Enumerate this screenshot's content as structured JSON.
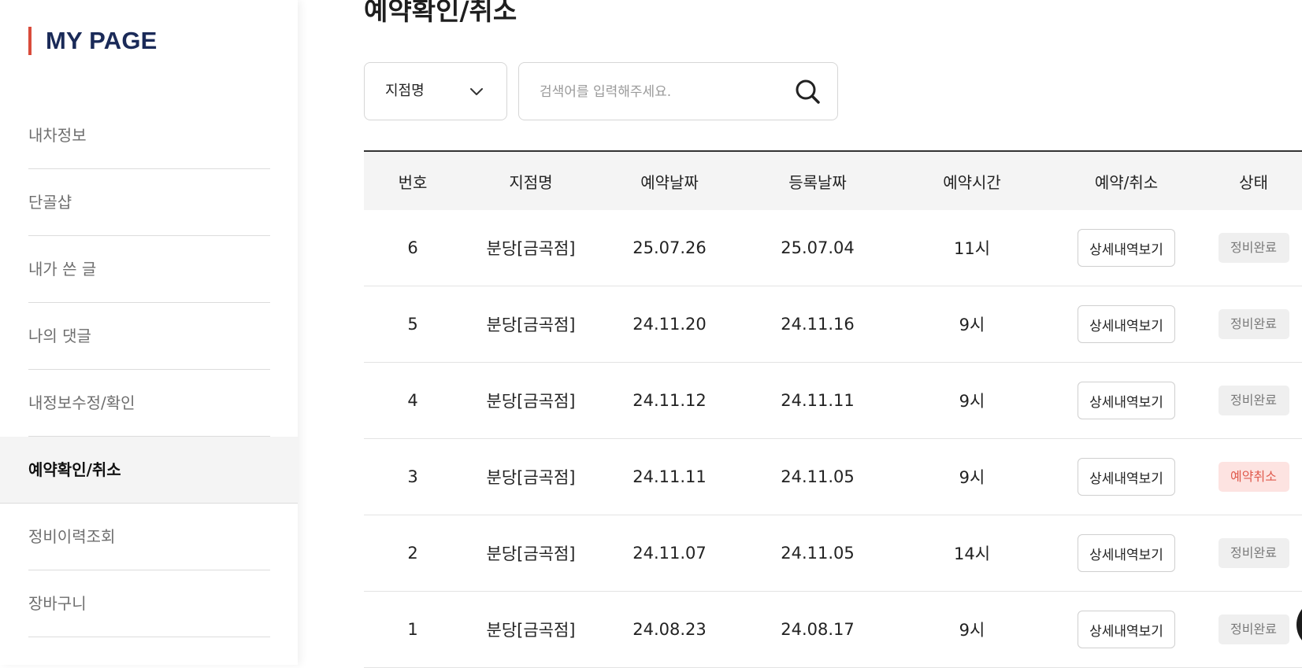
{
  "sidebar": {
    "title": "MY PAGE",
    "items": [
      {
        "label": "내차정보"
      },
      {
        "label": "단골샵"
      },
      {
        "label": "내가 쓴 글"
      },
      {
        "label": "나의 댓글"
      },
      {
        "label": "내정보수정/확인"
      },
      {
        "label": "예약확인/취소"
      },
      {
        "label": "정비이력조회"
      },
      {
        "label": "장바구니"
      }
    ],
    "active_index": 5
  },
  "main": {
    "title": "예약확인/취소",
    "filter": {
      "selected": "지점명",
      "search_placeholder": "검색어를 입력해주세요."
    },
    "table": {
      "headers": {
        "no": "번호",
        "branch": "지점명",
        "reserve_date": "예약날짜",
        "register_date": "등록날짜",
        "reserve_time": "예약시간",
        "action": "예약/취소",
        "status": "상태"
      },
      "rows": [
        {
          "no": "6",
          "branch": "분당[금곡점]",
          "reserve_date": "25.07.26",
          "register_date": "25.07.04",
          "reserve_time": "11시",
          "action": "상세내역보기",
          "status": "정비완료",
          "status_type": "done"
        },
        {
          "no": "5",
          "branch": "분당[금곡점]",
          "reserve_date": "24.11.20",
          "register_date": "24.11.16",
          "reserve_time": "9시",
          "action": "상세내역보기",
          "status": "정비완료",
          "status_type": "done"
        },
        {
          "no": "4",
          "branch": "분당[금곡점]",
          "reserve_date": "24.11.12",
          "register_date": "24.11.11",
          "reserve_time": "9시",
          "action": "상세내역보기",
          "status": "정비완료",
          "status_type": "done"
        },
        {
          "no": "3",
          "branch": "분당[금곡점]",
          "reserve_date": "24.11.11",
          "register_date": "24.11.05",
          "reserve_time": "9시",
          "action": "상세내역보기",
          "status": "예약취소",
          "status_type": "cancel"
        },
        {
          "no": "2",
          "branch": "분당[금곡점]",
          "reserve_date": "24.11.07",
          "register_date": "24.11.05",
          "reserve_time": "14시",
          "action": "상세내역보기",
          "status": "정비완료",
          "status_type": "done"
        },
        {
          "no": "1",
          "branch": "분당[금곡점]",
          "reserve_date": "24.08.23",
          "register_date": "24.08.17",
          "reserve_time": "9시",
          "action": "상세내역보기",
          "status": "정비완료",
          "status_type": "done"
        }
      ]
    }
  },
  "icons": {
    "select": "chevron-down-icon",
    "search": "search-icon"
  },
  "colors": {
    "brand_navy": "#1a2a58",
    "accent_red": "#d94b3b",
    "cancel_text": "#e05a4d",
    "cancel_bg": "#fde3e1"
  }
}
